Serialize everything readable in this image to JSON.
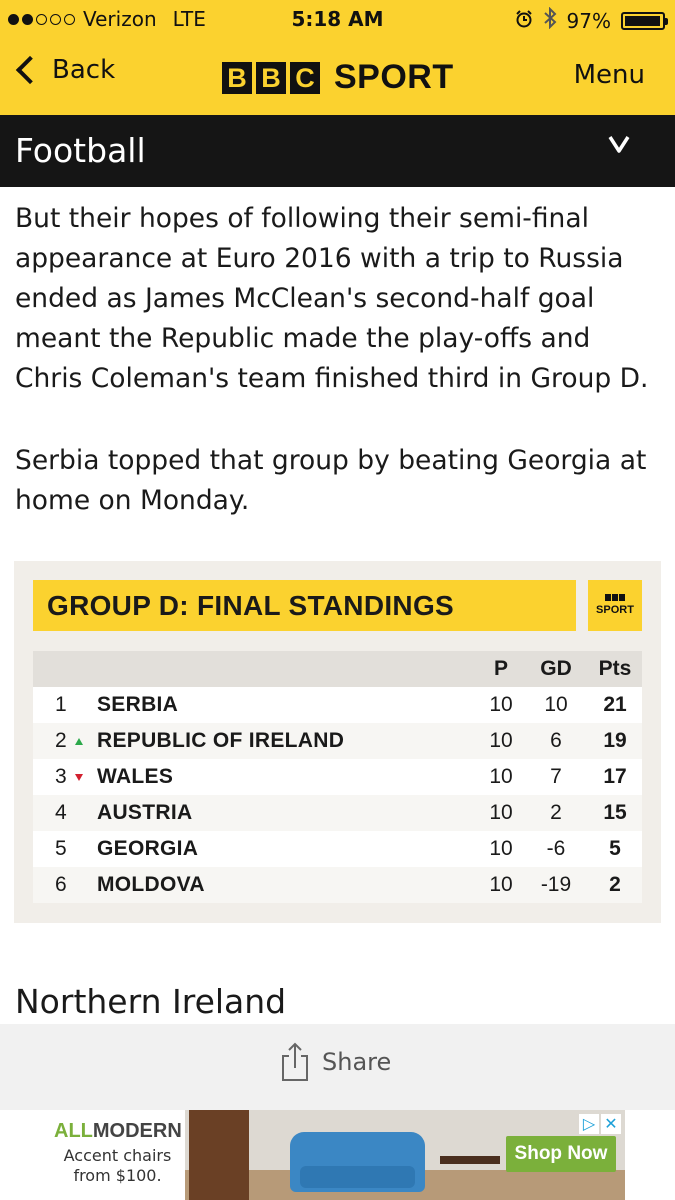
{
  "status_bar": {
    "carrier": "Verizon",
    "network": "LTE",
    "signal_bars_filled": 2,
    "signal_bars_total": 5,
    "time": "5:18 AM",
    "battery": "97%",
    "battery_level": 0.97,
    "icons": [
      "alarm-icon",
      "bluetooth-icon",
      "battery-icon"
    ]
  },
  "header": {
    "back_label": "Back",
    "logo_letters": [
      "B",
      "B",
      "C"
    ],
    "logo_word": "SPORT",
    "menu_label": "Menu",
    "background_color": "#fbd22f"
  },
  "section": {
    "title": "Football",
    "toggle_glyph": "V"
  },
  "article": {
    "paragraphs": [
      "But their hopes of following their semi-final appearance at Euro 2016 with a trip to Russia ended as James McClean's second-half goal meant the Republic made the play-offs and Chris Coleman's team finished third in Group D.",
      "Serbia topped that group by beating Georgia at home on Monday."
    ],
    "subheading": "Northern Ireland"
  },
  "standings": {
    "title": "GROUP D: FINAL STANDINGS",
    "logo_text": "SPORT",
    "columns": [
      "P",
      "GD",
      "Pts"
    ],
    "rows": [
      {
        "pos": "1",
        "team": "SERBIA",
        "p": "10",
        "gd": "10",
        "pts": "21",
        "movement": "none"
      },
      {
        "pos": "2",
        "team": "REPUBLIC OF IRELAND",
        "p": "10",
        "gd": "6",
        "pts": "19",
        "movement": "up"
      },
      {
        "pos": "3",
        "team": "WALES",
        "p": "10",
        "gd": "7",
        "pts": "17",
        "movement": "down"
      },
      {
        "pos": "4",
        "team": "AUSTRIA",
        "p": "10",
        "gd": "2",
        "pts": "15",
        "movement": "none"
      },
      {
        "pos": "5",
        "team": "GEORGIA",
        "p": "10",
        "gd": "-6",
        "pts": "5",
        "movement": "none"
      },
      {
        "pos": "6",
        "team": "MOLDOVA",
        "p": "10",
        "gd": "-19",
        "pts": "2",
        "movement": "none"
      }
    ],
    "colors": {
      "up": "#2ba84a",
      "down": "#d2202f"
    }
  },
  "share": {
    "label": "Share"
  },
  "ad": {
    "brand_part1": "ALL",
    "brand_part2": "MODERN",
    "copy_line1": "Accent chairs",
    "copy_line2": "from $100.",
    "cta": "Shop Now",
    "brand_color": "#7bb03b"
  }
}
